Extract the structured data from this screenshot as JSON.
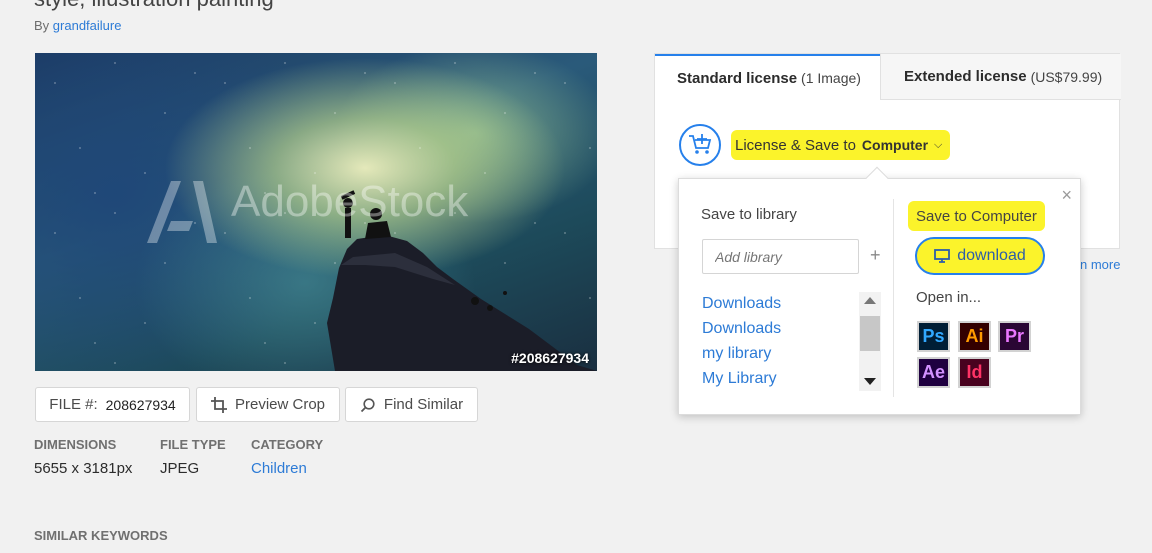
{
  "header": {
    "title": "style, illustration painting",
    "by_prefix": "By",
    "author": "grandfailure"
  },
  "image": {
    "watermark": "AdobeStock",
    "id_label": "#208627934"
  },
  "actions": {
    "file_label": "FILE #:",
    "file_number": "208627934",
    "preview_crop": "Preview Crop",
    "find_similar": "Find Similar"
  },
  "meta": {
    "dimensions_label": "DIMENSIONS",
    "dimensions_value": "5655 x 3181px",
    "filetype_label": "FILE TYPE",
    "filetype_value": "JPEG",
    "category_label": "CATEGORY",
    "category_value": "Children",
    "similar_keywords": "SIMILAR KEYWORDS"
  },
  "license": {
    "standard_tab": "Standard license",
    "standard_sub": "(1 Image)",
    "extended_tab": "Extended license",
    "extended_sub": "(US$79.99)",
    "save_prefix": "License & Save to",
    "save_target": "Computer",
    "learn_more": "n more"
  },
  "popover": {
    "library_title": "Save to library",
    "library_placeholder": "Add library",
    "libraries": [
      "Downloads",
      "Downloads",
      "my library",
      "My Library"
    ],
    "computer_title": "Save to Computer",
    "download_label": "download",
    "open_in_label": "Open in...",
    "apps": [
      {
        "label": "Ps",
        "name": "photoshop",
        "fg": "#31a8ff",
        "bg": "#001e36"
      },
      {
        "label": "Ai",
        "name": "illustrator",
        "fg": "#ff9a00",
        "bg": "#330000"
      },
      {
        "label": "Pr",
        "name": "premiere",
        "fg": "#ea77ff",
        "bg": "#2a0634"
      },
      {
        "label": "Ae",
        "name": "after-effects",
        "fg": "#d291ff",
        "bg": "#1f0040"
      },
      {
        "label": "Id",
        "name": "indesign",
        "fg": "#ff3366",
        "bg": "#49021f"
      }
    ]
  },
  "colors": {
    "accent": "#2680eb",
    "link": "#2d7bd6",
    "highlight": "#fbf32b"
  }
}
